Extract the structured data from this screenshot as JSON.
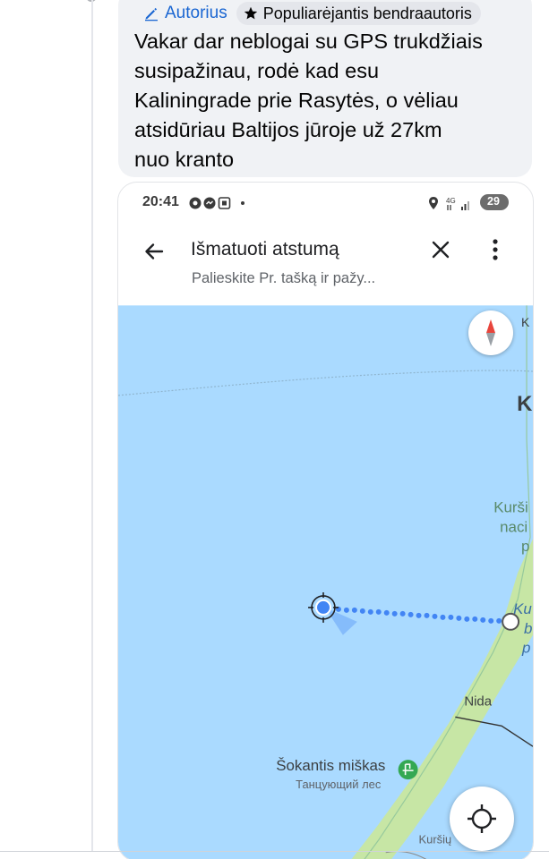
{
  "comment": {
    "author_badge": "Autorius",
    "top_contributor_badge": "Populiarėjantis bendraautoris",
    "text": "Vakar dar neblogai su GPS trukdžiais\nsusipažinau, rodė kad esu\nKaliningrade prie Rasytės, o vėliau\natsidūriau Baltijos jūroje už 27km\nnuo kranto"
  },
  "screenshot": {
    "status_bar": {
      "time": "20:41",
      "battery": "29"
    },
    "appbar": {
      "title": "Išmatuoti atstumą",
      "subtitle": "Palieskite Pr. tašką ir pažy..."
    },
    "map": {
      "labels": {
        "k_top": "K",
        "k_big": "K",
        "kursi": "Kurši",
        "naci": "naci",
        "p1": "p",
        "ku_italic": "Ku",
        "b_italic": "b",
        "p_italic": "p",
        "nida": "Nida",
        "sokantis": "Šokantis miškas",
        "tancuyushchiy": "Танцующий лес",
        "kursiu_bottom": "Kuršių"
      }
    },
    "colors": {
      "sea": "#aadaff",
      "land": "#c7e6a5",
      "route_dot": "#4285f4",
      "compass_red": "#e8453c"
    }
  }
}
